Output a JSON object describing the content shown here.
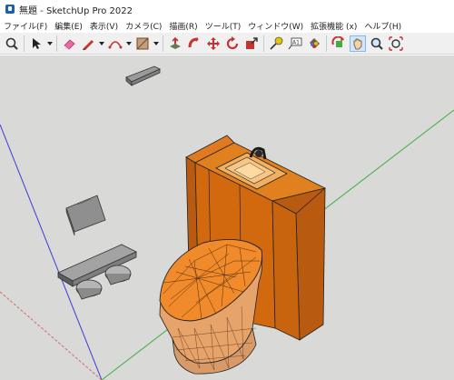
{
  "window": {
    "title": "無題 - SketchUp Pro 2022"
  },
  "menubar": {
    "items": [
      "ファイル(F)",
      "編集(E)",
      "表示(V)",
      "カメラ(C)",
      "描画(R)",
      "ツール(T)",
      "ウィンドウ(W)",
      "拡張機能 (x)",
      "ヘルプ(H)"
    ]
  },
  "toolbar": {
    "tools": [
      "zoom-window",
      "select",
      "eraser",
      "line",
      "arc",
      "rectangle",
      "push-pull",
      "follow-me",
      "move",
      "rotate",
      "scale",
      "tape-measure",
      "text",
      "paint-bucket",
      "orbit",
      "pan",
      "zoom",
      "zoom-extents"
    ],
    "active_tool": "pan",
    "accent": "#cfe6ff"
  },
  "viewport": {
    "background": "#d9d9d7",
    "axis_colors": {
      "red": "#d46b6b",
      "green": "#3fae3f",
      "blue": "#3b3bd6"
    },
    "model_color": "#d2690f"
  }
}
